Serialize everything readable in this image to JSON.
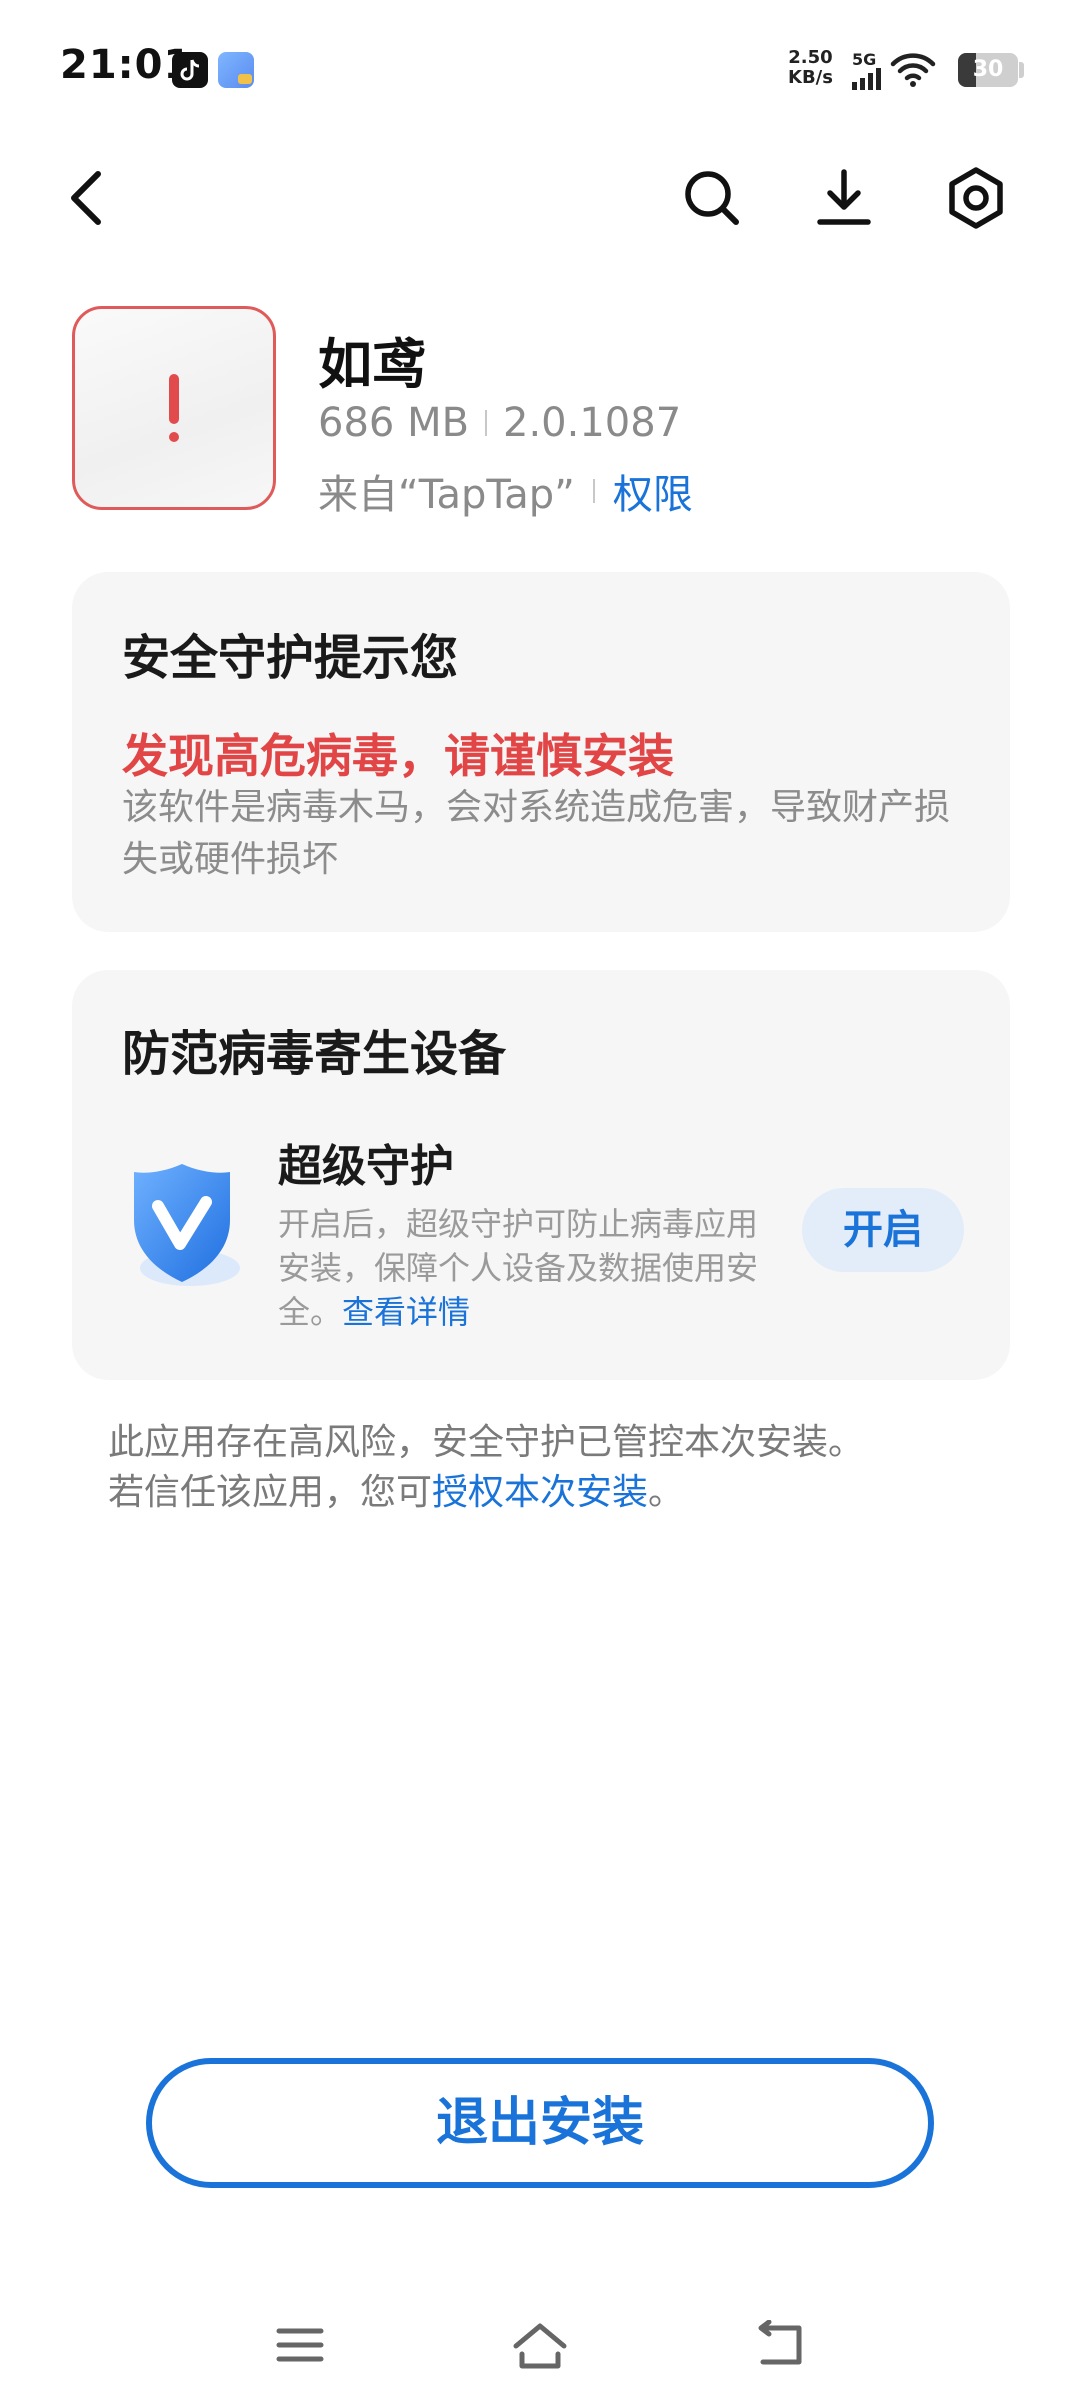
{
  "status_bar": {
    "time": "21:01",
    "net_speed_value": "2.50",
    "net_speed_unit": "KB/s",
    "network_type": "5G",
    "battery": "30",
    "notification_icons": [
      "tiktok-icon",
      "app-notification-icon"
    ]
  },
  "top_nav": {
    "back_icon": "chevron-left-icon",
    "search_icon": "search-icon",
    "download_icon": "download-icon",
    "settings_icon": "settings-hexagon-icon"
  },
  "app": {
    "name": "如鸢",
    "size": "686 MB",
    "version": "2.0.1087",
    "source": "来自“TapTap”",
    "permissions_link": "权限"
  },
  "security_card": {
    "title": "安全守护提示您",
    "danger_title": "发现高危病毒，请谨慎安装",
    "danger_desc": "该软件是病毒木马，会对系统造成危害，导致财产损失或硬件损坏"
  },
  "protect_card": {
    "title": "防范病毒寄生设备",
    "feature_title": "超级守护",
    "feature_desc": "开启后，超级守护可防止病毒应用安装，保障个人设备及数据使用安全。",
    "details_link": "查看详情",
    "enable_button": "开启"
  },
  "footer_note": {
    "line1": "此应用存在高风险，安全守护已管控本次安装。",
    "line2_prefix": "若信任该应用，您可",
    "authorize_link": "授权本次安装",
    "line2_suffix": "。"
  },
  "exit_button": "退出安装",
  "system_nav": {
    "menu_icon": "menu-icon",
    "home_icon": "home-icon",
    "back_icon": "back-icon"
  },
  "colors": {
    "accent": "#1a73d9",
    "danger": "#e24545",
    "card_bg": "#f6f6f6"
  }
}
